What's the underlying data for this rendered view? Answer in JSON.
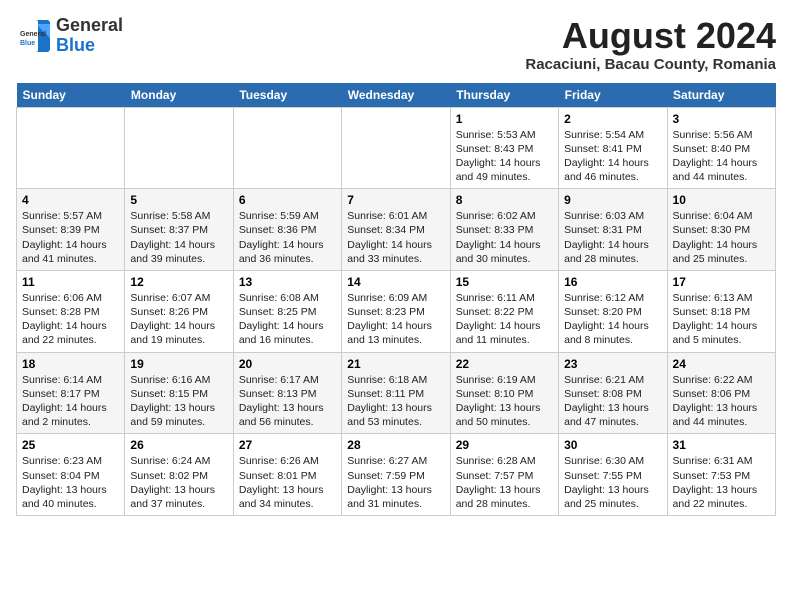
{
  "header": {
    "logo_general": "General",
    "logo_blue": "Blue",
    "month_year": "August 2024",
    "location": "Racaciuni, Bacau County, Romania"
  },
  "days_of_week": [
    "Sunday",
    "Monday",
    "Tuesday",
    "Wednesday",
    "Thursday",
    "Friday",
    "Saturday"
  ],
  "weeks": [
    [
      {
        "day": "",
        "info": ""
      },
      {
        "day": "",
        "info": ""
      },
      {
        "day": "",
        "info": ""
      },
      {
        "day": "",
        "info": ""
      },
      {
        "day": "1",
        "info": "Sunrise: 5:53 AM\nSunset: 8:43 PM\nDaylight: 14 hours and 49 minutes."
      },
      {
        "day": "2",
        "info": "Sunrise: 5:54 AM\nSunset: 8:41 PM\nDaylight: 14 hours and 46 minutes."
      },
      {
        "day": "3",
        "info": "Sunrise: 5:56 AM\nSunset: 8:40 PM\nDaylight: 14 hours and 44 minutes."
      }
    ],
    [
      {
        "day": "4",
        "info": "Sunrise: 5:57 AM\nSunset: 8:39 PM\nDaylight: 14 hours and 41 minutes."
      },
      {
        "day": "5",
        "info": "Sunrise: 5:58 AM\nSunset: 8:37 PM\nDaylight: 14 hours and 39 minutes."
      },
      {
        "day": "6",
        "info": "Sunrise: 5:59 AM\nSunset: 8:36 PM\nDaylight: 14 hours and 36 minutes."
      },
      {
        "day": "7",
        "info": "Sunrise: 6:01 AM\nSunset: 8:34 PM\nDaylight: 14 hours and 33 minutes."
      },
      {
        "day": "8",
        "info": "Sunrise: 6:02 AM\nSunset: 8:33 PM\nDaylight: 14 hours and 30 minutes."
      },
      {
        "day": "9",
        "info": "Sunrise: 6:03 AM\nSunset: 8:31 PM\nDaylight: 14 hours and 28 minutes."
      },
      {
        "day": "10",
        "info": "Sunrise: 6:04 AM\nSunset: 8:30 PM\nDaylight: 14 hours and 25 minutes."
      }
    ],
    [
      {
        "day": "11",
        "info": "Sunrise: 6:06 AM\nSunset: 8:28 PM\nDaylight: 14 hours and 22 minutes."
      },
      {
        "day": "12",
        "info": "Sunrise: 6:07 AM\nSunset: 8:26 PM\nDaylight: 14 hours and 19 minutes."
      },
      {
        "day": "13",
        "info": "Sunrise: 6:08 AM\nSunset: 8:25 PM\nDaylight: 14 hours and 16 minutes."
      },
      {
        "day": "14",
        "info": "Sunrise: 6:09 AM\nSunset: 8:23 PM\nDaylight: 14 hours and 13 minutes."
      },
      {
        "day": "15",
        "info": "Sunrise: 6:11 AM\nSunset: 8:22 PM\nDaylight: 14 hours and 11 minutes."
      },
      {
        "day": "16",
        "info": "Sunrise: 6:12 AM\nSunset: 8:20 PM\nDaylight: 14 hours and 8 minutes."
      },
      {
        "day": "17",
        "info": "Sunrise: 6:13 AM\nSunset: 8:18 PM\nDaylight: 14 hours and 5 minutes."
      }
    ],
    [
      {
        "day": "18",
        "info": "Sunrise: 6:14 AM\nSunset: 8:17 PM\nDaylight: 14 hours and 2 minutes."
      },
      {
        "day": "19",
        "info": "Sunrise: 6:16 AM\nSunset: 8:15 PM\nDaylight: 13 hours and 59 minutes."
      },
      {
        "day": "20",
        "info": "Sunrise: 6:17 AM\nSunset: 8:13 PM\nDaylight: 13 hours and 56 minutes."
      },
      {
        "day": "21",
        "info": "Sunrise: 6:18 AM\nSunset: 8:11 PM\nDaylight: 13 hours and 53 minutes."
      },
      {
        "day": "22",
        "info": "Sunrise: 6:19 AM\nSunset: 8:10 PM\nDaylight: 13 hours and 50 minutes."
      },
      {
        "day": "23",
        "info": "Sunrise: 6:21 AM\nSunset: 8:08 PM\nDaylight: 13 hours and 47 minutes."
      },
      {
        "day": "24",
        "info": "Sunrise: 6:22 AM\nSunset: 8:06 PM\nDaylight: 13 hours and 44 minutes."
      }
    ],
    [
      {
        "day": "25",
        "info": "Sunrise: 6:23 AM\nSunset: 8:04 PM\nDaylight: 13 hours and 40 minutes."
      },
      {
        "day": "26",
        "info": "Sunrise: 6:24 AM\nSunset: 8:02 PM\nDaylight: 13 hours and 37 minutes."
      },
      {
        "day": "27",
        "info": "Sunrise: 6:26 AM\nSunset: 8:01 PM\nDaylight: 13 hours and 34 minutes."
      },
      {
        "day": "28",
        "info": "Sunrise: 6:27 AM\nSunset: 7:59 PM\nDaylight: 13 hours and 31 minutes."
      },
      {
        "day": "29",
        "info": "Sunrise: 6:28 AM\nSunset: 7:57 PM\nDaylight: 13 hours and 28 minutes."
      },
      {
        "day": "30",
        "info": "Sunrise: 6:30 AM\nSunset: 7:55 PM\nDaylight: 13 hours and 25 minutes."
      },
      {
        "day": "31",
        "info": "Sunrise: 6:31 AM\nSunset: 7:53 PM\nDaylight: 13 hours and 22 minutes."
      }
    ]
  ]
}
